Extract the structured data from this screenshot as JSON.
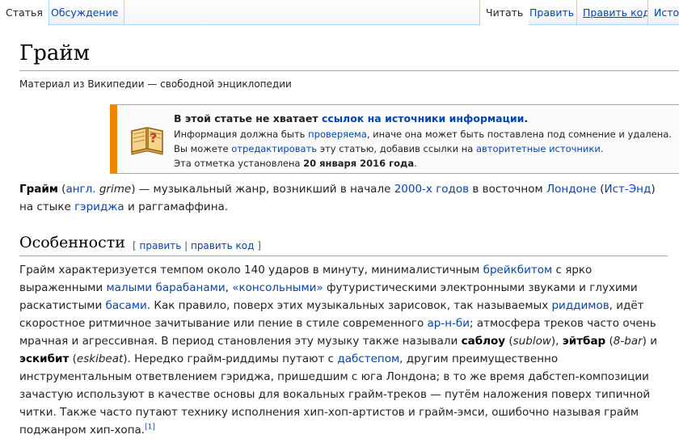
{
  "tabs": {
    "left": [
      "Статья",
      "Обсуждение"
    ],
    "right": [
      "Читать",
      "Править",
      "Править код",
      "Истор"
    ]
  },
  "article": {
    "title": "Грайм",
    "tagline": "Материал из Википедии — свободной энциклопедии"
  },
  "notice": {
    "headline_pre": "В этой статье не хватает ",
    "headline_link": "ссылок на источники информации",
    "headline_post": ".",
    "line1_pre": "Информация должна быть ",
    "line1_link": "проверяема",
    "line1_post": ", иначе она может быть поставлена под сомнение и удалена.",
    "line2_pre": "Вы можете ",
    "line2_link1": "отредактировать",
    "line2_mid": " эту статью, добавив ссылки на ",
    "line2_link2": "авторитетные источники",
    "line2_post": ".",
    "line3_pre": "Эта отметка установлена ",
    "line3_date": "20 января 2016 года",
    "line3_post": ".",
    "icon": "book-question-icon"
  },
  "intro": {
    "p1_bold": "Грайм",
    "p1_a": " (",
    "p1_link_lang": "англ.",
    "p1_b": " ",
    "p1_term": "grime",
    "p1_c": ") — музыкальный жанр, возникший в начале ",
    "p1_link_2000s": "2000-х годов",
    "p1_d": " в восточном ",
    "p1_link_london": "Лондоне",
    "p1_e": " (",
    "p1_link_eastend": "Ист-Энд",
    "p1_f": ") на стыке ",
    "p1_link_garage": "гэриджа",
    "p1_g": " и раггамаффина."
  },
  "section": {
    "heading": "Особенности",
    "edit_open": "[",
    "edit_label": "править",
    "edit_sep": "|",
    "editcode_label": "править код",
    "edit_close": "]",
    "t1": "Грайм характеризуется темпом около 140 ударов в минуту, минималистичным ",
    "l_breakbeat": "брейкбитом",
    "t2": " с ярко выраженными ",
    "l_small_drums": "малыми барабанами",
    "t3": ", ",
    "l_console": "«консольными»",
    "t4": " футуристическими электронными звуками и глухими раскатистыми ",
    "l_bass": "басами",
    "t5": ". Как правило, поверх этих музыкальных зарисовок, так называемых ",
    "l_riddims": "риддимов",
    "t6": ", идёт скоростное ритмичное зачитывание или пение в стиле современного ",
    "l_rnb": "ар-н-би",
    "t7": "; атмосфера треков часто очень мрачная и агрессивная. В период становления эту музыку также называли ",
    "b_sablou": "саблоу",
    "t8": " (",
    "i_sublow": "sublow",
    "t9": "), ",
    "b_eightbar": "эйтбар",
    "t10": " (",
    "i_8bar": "8-bar",
    "t11": ") и ",
    "b_eskibeat": "эскибит",
    "t12": " (",
    "i_eskibeat": "eskibeat",
    "t13": "). Нередко грайм-риддимы путают с ",
    "l_dubstep": "дабстепом",
    "t14": ", другим преимущественно инструментальным ответвлением гэриджа, пришедшим с юга Лондона; в то же время дабстеп-композиции зачастую используют в качестве основы для вокальных грайм-треков — путём наложения поверх типичной читки. Также часто путают технику исполнения хип-хоп-артистов и грайм-эмси, ошибочно называя грайм поджанром хип-хопа.",
    "ref": "[1]"
  }
}
